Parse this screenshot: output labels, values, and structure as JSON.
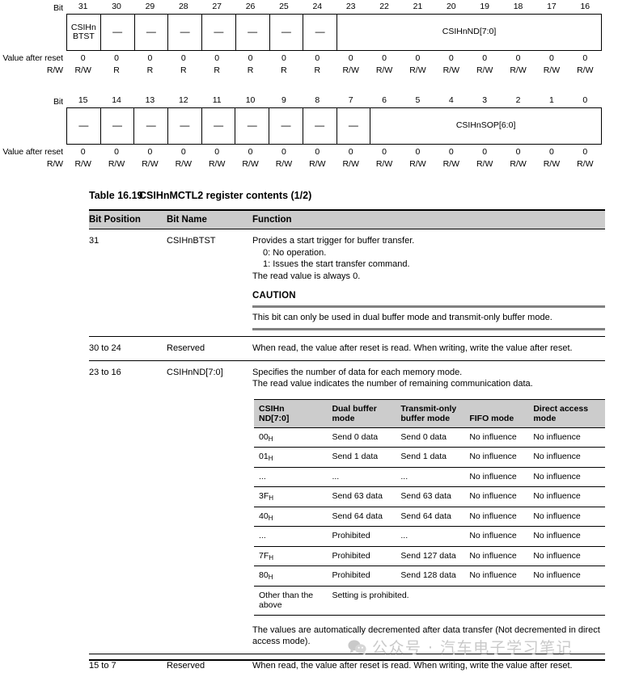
{
  "register_upper": {
    "side_labels": {
      "bit": "Bit",
      "value_after_reset": "Value after reset",
      "rw": "R/W"
    },
    "bit_numbers": [
      "31",
      "30",
      "29",
      "28",
      "27",
      "26",
      "25",
      "24",
      "23",
      "22",
      "21",
      "20",
      "19",
      "18",
      "17",
      "16"
    ],
    "fields": [
      {
        "label": "CSIHn\nBTST",
        "span": 1
      },
      {
        "label": "—",
        "span": 1
      },
      {
        "label": "—",
        "span": 1
      },
      {
        "label": "—",
        "span": 1
      },
      {
        "label": "—",
        "span": 1
      },
      {
        "label": "—",
        "span": 1
      },
      {
        "label": "—",
        "span": 1
      },
      {
        "label": "—",
        "span": 1
      },
      {
        "label": "CSIHnND[7:0]",
        "span": 8
      }
    ],
    "reset_values": [
      "0",
      "0",
      "0",
      "0",
      "0",
      "0",
      "0",
      "0",
      "0",
      "0",
      "0",
      "0",
      "0",
      "0",
      "0",
      "0"
    ],
    "rw_values": [
      "R/W",
      "R",
      "R",
      "R",
      "R",
      "R",
      "R",
      "R",
      "R/W",
      "R/W",
      "R/W",
      "R/W",
      "R/W",
      "R/W",
      "R/W",
      "R/W"
    ]
  },
  "register_lower": {
    "side_labels": {
      "bit": "Bit",
      "value_after_reset": "Value after reset",
      "rw": "R/W"
    },
    "bit_numbers": [
      "15",
      "14",
      "13",
      "12",
      "11",
      "10",
      "9",
      "8",
      "7",
      "6",
      "5",
      "4",
      "3",
      "2",
      "1",
      "0"
    ],
    "fields": [
      {
        "label": "—",
        "span": 1
      },
      {
        "label": "—",
        "span": 1
      },
      {
        "label": "—",
        "span": 1
      },
      {
        "label": "—",
        "span": 1
      },
      {
        "label": "—",
        "span": 1
      },
      {
        "label": "—",
        "span": 1
      },
      {
        "label": "—",
        "span": 1
      },
      {
        "label": "—",
        "span": 1
      },
      {
        "label": "—",
        "span": 1
      },
      {
        "label": "CSIHnSOP[6:0]",
        "span": 7
      }
    ],
    "reset_values": [
      "0",
      "0",
      "0",
      "0",
      "0",
      "0",
      "0",
      "0",
      "0",
      "0",
      "0",
      "0",
      "0",
      "0",
      "0",
      "0"
    ],
    "rw_values": [
      "R/W",
      "R/W",
      "R/W",
      "R/W",
      "R/W",
      "R/W",
      "R/W",
      "R/W",
      "R/W",
      "R/W",
      "R/W",
      "R/W",
      "R/W",
      "R/W",
      "R/W",
      "R/W"
    ]
  },
  "table_caption": {
    "number": "Table 16.19",
    "title": "CSIHnMCTL2 register contents (1/2)"
  },
  "table_headers": {
    "bit_position": "Bit Position",
    "bit_name": "Bit Name",
    "function": "Function"
  },
  "rows": {
    "row_31": {
      "bit_position": "31",
      "bit_name": "CSIHnBTST",
      "function_line1": "Provides a start trigger for buffer transfer.",
      "function_line2": "0: No operation.",
      "function_line3": "1: Issues the start transfer command.",
      "function_line4": "The read value is always 0.",
      "caution_title": "CAUTION",
      "caution_text": "This bit can only be used in dual buffer mode and transmit-only buffer mode."
    },
    "row_30_24": {
      "bit_position": "30 to 24",
      "bit_name": "Reserved",
      "function": "When read, the value after reset is read. When writing, write the value after reset."
    },
    "row_23_16": {
      "bit_position": "23 to 16",
      "bit_name": "CSIHnND[7:0]",
      "function_line1": "Specifies the number of data for each memory mode.",
      "function_line2": "The read value indicates the number of remaining communication data.",
      "footer_note": "The values are automatically decremented after data transfer (Not decremented in direct access mode)."
    },
    "row_15_7": {
      "bit_position": "15 to 7",
      "bit_name": "Reserved",
      "function": "When read, the value after reset is read. When writing, write the value after reset."
    }
  },
  "inner_table": {
    "headers": [
      "CSIHn\nND[7:0]",
      "Dual buffer\nmode",
      "Transmit-only\nbuffer mode",
      "FIFO mode",
      "Direct access\nmode"
    ],
    "header_parts": {
      "h1a": "CSIHn",
      "h1b": "ND[7:0]",
      "h2a": "Dual buffer",
      "h2b": "mode",
      "h3a": "Transmit-only",
      "h3b": "buffer mode",
      "h4a": "FIFO mode",
      "h4b": "",
      "h5a": "Direct access",
      "h5b": "mode"
    },
    "rows": [
      {
        "code": "00",
        "sub": "H",
        "dual": "Send 0 data",
        "txonly": "Send 0 data",
        "fifo": "No influence",
        "direct": "No influence"
      },
      {
        "code": "01",
        "sub": "H",
        "dual": "Send 1 data",
        "txonly": "Send 1 data",
        "fifo": "No influence",
        "direct": "No influence"
      },
      {
        "code": "...",
        "sub": "",
        "dual": "...",
        "txonly": "...",
        "fifo": "No influence",
        "direct": "No influence"
      },
      {
        "code": "3F",
        "sub": "H",
        "dual": "Send 63 data",
        "txonly": "Send 63 data",
        "fifo": "No influence",
        "direct": "No influence"
      },
      {
        "code": "40",
        "sub": "H",
        "dual": "Send 64 data",
        "txonly": "Send 64 data",
        "fifo": "No influence",
        "direct": "No influence"
      },
      {
        "code": "...",
        "sub": "",
        "dual": "Prohibited",
        "txonly": "...",
        "fifo": "No influence",
        "direct": "No influence"
      },
      {
        "code": "7F",
        "sub": "H",
        "dual": "Prohibited",
        "txonly": "Send 127 data",
        "fifo": "No influence",
        "direct": "No influence"
      },
      {
        "code": "80",
        "sub": "H",
        "dual": "Prohibited",
        "txonly": "Send 128 data",
        "fifo": "No influence",
        "direct": "No influence"
      }
    ],
    "last_row": {
      "code_line1": "Other than the",
      "code_line2": "above",
      "value": "Setting is prohibited."
    }
  },
  "watermark": {
    "text": "公众号 · 汽车电子学习笔记",
    "color": "#c9c9c9"
  }
}
